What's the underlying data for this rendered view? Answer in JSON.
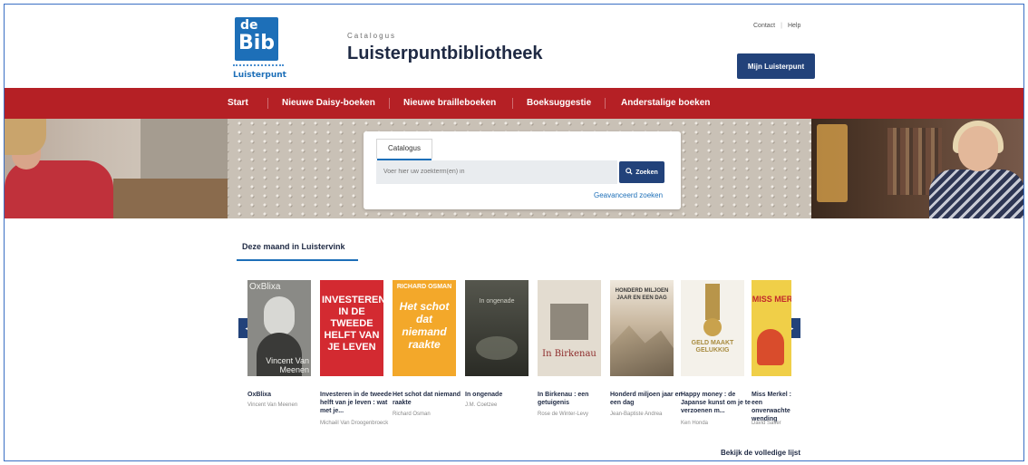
{
  "header": {
    "logo": {
      "line1": "de",
      "line2": "Bib",
      "line3": "Luisterpunt"
    },
    "catalog_label": "Catalogus",
    "site_title": "Luisterpuntbibliotheek",
    "util_links": [
      "Contact",
      "Help"
    ],
    "account_button": "Mijn Luisterpunt"
  },
  "nav": {
    "items": [
      "Start",
      "Nieuwe Daisy-boeken",
      "Nieuwe brailleboeken",
      "Boeksuggestie",
      "Anderstalige boeken"
    ]
  },
  "search": {
    "tab_label": "Catalogus",
    "placeholder": "Voer hier uw zoekterm(en) in",
    "button_label": "Zoeken",
    "advanced_link": "Geavanceerd zoeken"
  },
  "section": {
    "tab_label": "Deze maand in Luistervink",
    "full_list_link": "Bekijk de volledige lijst"
  },
  "books": [
    {
      "title": "OxBlixa",
      "author": "Vincent Van Meenen",
      "cover_text": "OxBlixa",
      "cover_sub": "Vincent Van Meenen",
      "cover_color": "#8a8a86"
    },
    {
      "title": "Investeren in de tweede helft van je leven : wat met je...",
      "author": "Michaël Van Droogenbroeck",
      "cover_text": "INVESTEREN IN DE TWEEDE HELFT VAN JE LEVEN",
      "cover_color": "#d32a31"
    },
    {
      "title": "Het schot dat niemand raakte",
      "author": "Richard Osman",
      "cover_text": "Het schot dat niemand raakte",
      "cover_sub": "RICHARD OSMAN",
      "cover_color": "#f3a82a"
    },
    {
      "title": "In ongenade",
      "author": "J.M. Coetzee",
      "cover_text": "In ongenade",
      "cover_color": "#3a3b35"
    },
    {
      "title": "In Birkenau : een getuigenis",
      "author": "Rose de Winter-Levy",
      "cover_text": "In Birkenau",
      "cover_color": "#e3dcd0"
    },
    {
      "title": "Honderd miljoen jaar en een dag",
      "author": "Jean-Baptiste Andrea",
      "cover_text": "HONDERD MILJOEN JAAR EN EEN DAG",
      "cover_color": "#c9b8a0"
    },
    {
      "title": "Happy money : de Japanse kunst om je te verzoenen m...",
      "author": "Ken Honda",
      "cover_text": "GELD MAAKT GELUKKIG",
      "cover_color": "#f4f1ea"
    },
    {
      "title": "Miss Merkel : een onverwachte wending",
      "author": "David Safier",
      "cover_text": "MISS MERKEL",
      "cover_color": "#f0cf48"
    }
  ],
  "colors": {
    "brand_blue": "#22427a",
    "nav_red": "#b52025",
    "link_blue": "#1d6fb8"
  },
  "icons": {
    "search": "magnifier",
    "prev": "chevron-left",
    "next": "chevron-right"
  }
}
